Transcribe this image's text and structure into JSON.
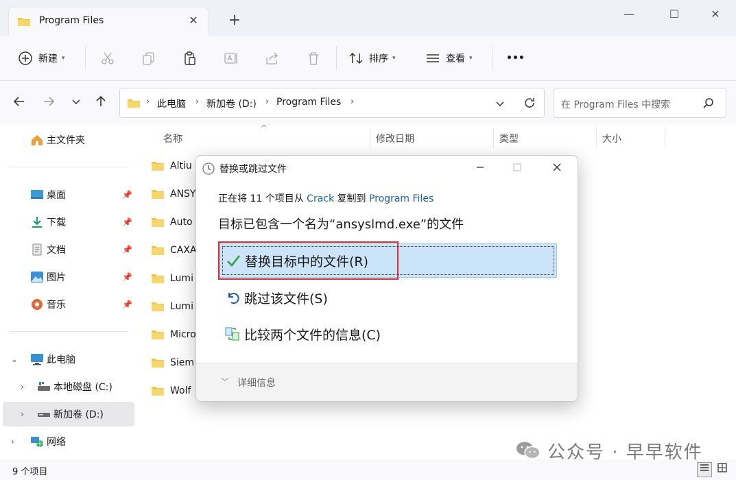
{
  "window": {
    "tab_title": "Program Files",
    "close_glyph": "✕",
    "new_tab_glyph": "+",
    "minimize_glyph": "—",
    "maximize_glyph": "☐",
    "close_window_glyph": "✕"
  },
  "toolbar": {
    "new_label": "新建",
    "sort_label": "排序",
    "view_label": "查看",
    "more_label": "•••",
    "icons": [
      "new-icon",
      "cut-icon",
      "copy-icon",
      "paste-icon",
      "rename-icon",
      "share-icon",
      "delete-icon",
      "sort-icon",
      "view-icon",
      "more-icon"
    ]
  },
  "address": {
    "crumbs": [
      "此电脑",
      "新加卷 (D:)",
      "Program Files"
    ],
    "search_placeholder": "在 Program Files 中搜索"
  },
  "sidebar": {
    "home": "主文件夹",
    "quick_access": [
      {
        "label": "桌面",
        "icon": "desktop-icon"
      },
      {
        "label": "下载",
        "icon": "download-icon"
      },
      {
        "label": "文档",
        "icon": "document-icon"
      },
      {
        "label": "图片",
        "icon": "picture-icon"
      },
      {
        "label": "音乐",
        "icon": "music-icon"
      }
    ],
    "this_pc": "此电脑",
    "drives": [
      {
        "label": "本地磁盘 (C:)",
        "selected": false
      },
      {
        "label": "新加卷 (D:)",
        "selected": true
      }
    ],
    "network": "网络"
  },
  "filelist": {
    "columns": [
      "名称",
      "修改日期",
      "类型",
      "大小"
    ],
    "sort_glyph": "^",
    "items": [
      "Altiu",
      "ANSY",
      "Auto",
      "CAXA",
      "Lumi",
      "Lumi",
      "Micro",
      "Siem",
      "Wolf"
    ]
  },
  "status": {
    "count_text": "9 个项目"
  },
  "dialog": {
    "title": "替换或跳过文件",
    "info_prefix": "正在将 11 个项目从 ",
    "info_source": "Crack",
    "info_middle": " 复制到 ",
    "info_dest": "Program Files",
    "heading": "目标已包含一个名为“ansyslmd.exe”的文件",
    "options": [
      {
        "label": "替换目标中的文件(R)",
        "icon": "checkmark-icon"
      },
      {
        "label": "跳过该文件(S)",
        "icon": "undo-icon"
      },
      {
        "label": "比较两个文件的信息(C)",
        "icon": "compare-icon"
      }
    ],
    "details_label": "详细信息",
    "details_glyph": "﹀"
  },
  "watermark": {
    "text": "公众号 · 早早软件"
  },
  "colors": {
    "accent_blue": "#1a5fb4",
    "highlight_bg": "#cce4f7",
    "red_annotation": "#d9303a",
    "folder_yellow": "#f2c744"
  }
}
